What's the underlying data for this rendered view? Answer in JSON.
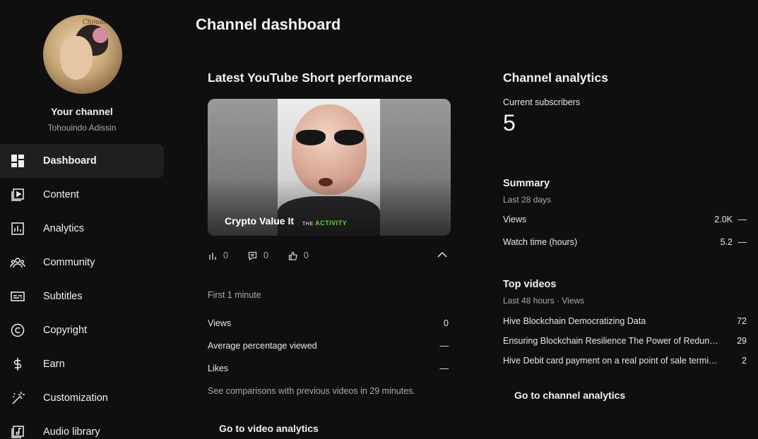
{
  "sidebar": {
    "channel_title": "Your channel",
    "channel_handle": "Tohouindo Adissin",
    "avatar_text": "Chinoise",
    "items": [
      {
        "label": "Dashboard",
        "icon": "dashboard-icon",
        "active": true
      },
      {
        "label": "Content",
        "icon": "content-icon"
      },
      {
        "label": "Analytics",
        "icon": "analytics-icon"
      },
      {
        "label": "Community",
        "icon": "community-icon"
      },
      {
        "label": "Subtitles",
        "icon": "subtitles-icon"
      },
      {
        "label": "Copyright",
        "icon": "copyright-icon"
      },
      {
        "label": "Earn",
        "icon": "dollar-icon"
      },
      {
        "label": "Customization",
        "icon": "magic-wand-icon"
      },
      {
        "label": "Audio library",
        "icon": "audio-library-icon"
      }
    ]
  },
  "page": {
    "title": "Channel dashboard"
  },
  "short_card": {
    "title": "Latest YouTube Short performance",
    "video_title": "Crypto Value It",
    "watermark_small": "THE",
    "watermark": "ACTIVITY",
    "stats": {
      "views": "0",
      "comments": "0",
      "likes": "0"
    },
    "period": "First 1 minute",
    "metrics": [
      {
        "label": "Views",
        "value": "0"
      },
      {
        "label": "Average percentage viewed",
        "value": "—"
      },
      {
        "label": "Likes",
        "value": "—"
      }
    ],
    "note": "See comparisons with previous videos in 29 minutes.",
    "button": "Go to video analytics"
  },
  "analytics_card": {
    "title": "Channel analytics",
    "subscribers_label": "Current subscribers",
    "subscribers_value": "5",
    "summary_title": "Summary",
    "summary_period": "Last 28 days",
    "summary_rows": [
      {
        "label": "Views",
        "value": "2.0K",
        "trend": "—"
      },
      {
        "label": "Watch time (hours)",
        "value": "5.2",
        "trend": "—"
      }
    ],
    "top_title": "Top videos",
    "top_period": "Last 48 hours · Views",
    "top_videos": [
      {
        "title": "Hive Blockchain Democratizing Data",
        "views": "72"
      },
      {
        "title": "Ensuring Blockchain Resilience The Power of Redundancy",
        "views": "29"
      },
      {
        "title": "Hive Debit card payment on a real point of sale terminal",
        "views": "2"
      }
    ],
    "button": "Go to channel analytics"
  },
  "colors": {
    "background": "#0f0f0f",
    "active_nav": "#1f1f1f",
    "text_primary": "#f1f1f1",
    "text_secondary": "#aaaaaa",
    "watermark_green": "#6ccf48"
  }
}
